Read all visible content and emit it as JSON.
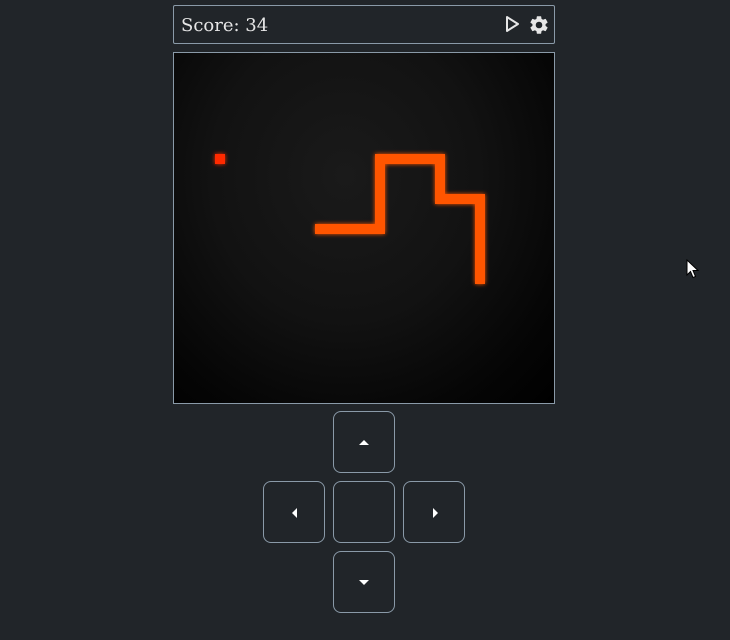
{
  "score_label": "Score: 34",
  "colors": {
    "background": "#212529",
    "border": "#8a9aa8",
    "snake": "#ff5500",
    "food": "#ff2a00",
    "text": "#e6e6e6"
  },
  "icons": {
    "play": "play-icon",
    "settings": "gear-icon"
  },
  "game": {
    "grid_unit": "cell",
    "snake_cells": [
      [
        14,
        17
      ],
      [
        15,
        17
      ],
      [
        16,
        17
      ],
      [
        17,
        17
      ],
      [
        18,
        17
      ],
      [
        19,
        17
      ],
      [
        20,
        17
      ],
      [
        20,
        16
      ],
      [
        20,
        15
      ],
      [
        20,
        14
      ],
      [
        20,
        13
      ],
      [
        20,
        12
      ],
      [
        20,
        11
      ],
      [
        20,
        10
      ],
      [
        21,
        10
      ],
      [
        22,
        10
      ],
      [
        23,
        10
      ],
      [
        24,
        10
      ],
      [
        25,
        10
      ],
      [
        26,
        10
      ],
      [
        26,
        11
      ],
      [
        26,
        12
      ],
      [
        26,
        13
      ],
      [
        26,
        14
      ],
      [
        27,
        14
      ],
      [
        28,
        14
      ],
      [
        29,
        14
      ],
      [
        30,
        14
      ],
      [
        30,
        15
      ],
      [
        30,
        16
      ],
      [
        30,
        17
      ],
      [
        30,
        18
      ],
      [
        30,
        19
      ],
      [
        30,
        20
      ],
      [
        30,
        21
      ],
      [
        30,
        22
      ]
    ],
    "food_cell": [
      4,
      10
    ]
  },
  "controls": {
    "up": "up-arrow",
    "down": "down-arrow",
    "left": "left-arrow",
    "right": "right-arrow"
  }
}
